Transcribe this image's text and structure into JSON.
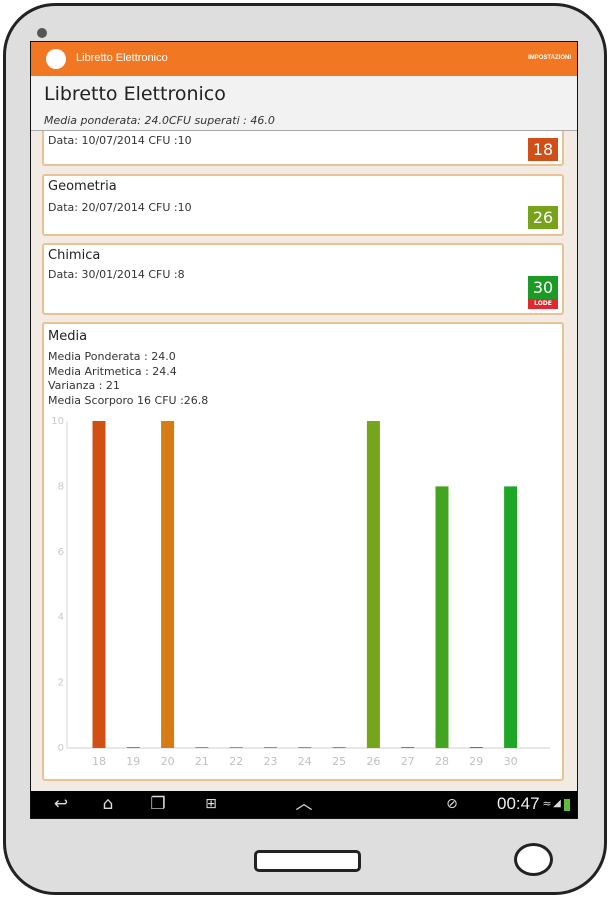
{
  "app": {
    "logo_text": "",
    "title": "Libretto Elettronico",
    "settings_label": "IMPOSTAZIONI"
  },
  "header": {
    "title": "Libretto Elettronico",
    "subtitle": "Media ponderata: 24.0CFU superati : 46.0"
  },
  "exams": [
    {
      "name": "",
      "info": "Data: 10/07/2014 CFU :10",
      "grade": "18",
      "color": "#cf4f17"
    },
    {
      "name": "Geometria",
      "info": "Data: 20/07/2014 CFU :10",
      "grade": "26",
      "color": "#77a21a"
    },
    {
      "name": "Chimica",
      "info": "Data: 30/01/2014 CFU :8",
      "grade": "30",
      "color": "#1c9a26",
      "badge": "LODE"
    }
  ],
  "media": {
    "title": "Media",
    "stats": [
      "Media Ponderata : 24.0",
      "Media Aritmetica : 24.4",
      "Varianza : 21",
      "Media Scorporo 16 CFU :26.8"
    ]
  },
  "chart_data": {
    "type": "bar",
    "categories": [
      "18",
      "19",
      "20",
      "21",
      "22",
      "23",
      "24",
      "25",
      "26",
      "27",
      "28",
      "29",
      "30"
    ],
    "values": [
      10,
      0,
      10,
      0,
      0,
      0,
      0,
      0,
      10,
      0,
      8,
      0,
      8
    ],
    "colors": [
      "#d24f14",
      "#dc6b17",
      "#d67c15",
      "#c89017",
      "#b89c18",
      "#a5a21a",
      "#94a61b",
      "#84a61b",
      "#74a51a",
      "#56a31c",
      "#42a420",
      "#2ca423",
      "#1ea726"
    ],
    "yticks": [
      "0",
      "2",
      "4",
      "6",
      "8",
      "10"
    ],
    "ylim": [
      0,
      10
    ],
    "xlabel": "",
    "ylabel": "",
    "grid": false
  },
  "navbar": {
    "back_icon": "back-icon",
    "home_icon": "home-icon",
    "recents_icon": "recents-icon",
    "screenshot_icon": "screenshot-icon",
    "up_icon": "chevron-up-icon",
    "time": "00:47"
  }
}
